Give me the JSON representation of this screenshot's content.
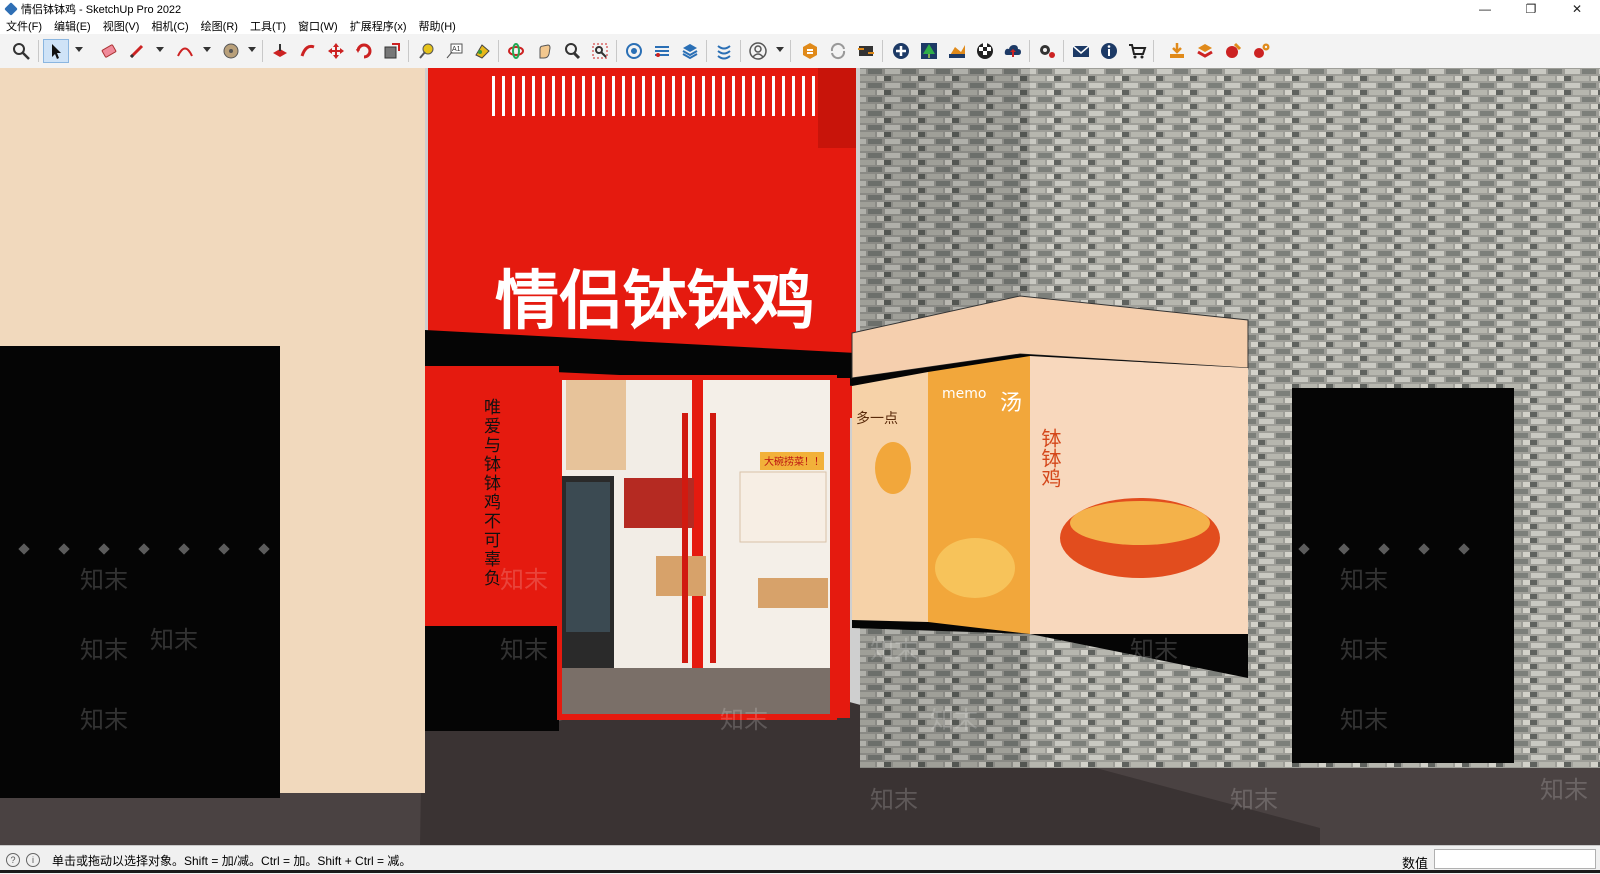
{
  "window": {
    "title": "情侣钵钵鸡 - SketchUp Pro 2022",
    "minimize": "—",
    "restore": "❐",
    "close": "✕"
  },
  "menu": [
    "文件(F)",
    "编辑(E)",
    "视图(V)",
    "相机(C)",
    "绘图(R)",
    "工具(T)",
    "窗口(W)",
    "扩展程序(x)",
    "帮助(H)"
  ],
  "toolbar": {
    "icons": [
      "zoom-extents-icon",
      "select-icon",
      "eraser-icon",
      "pencil-icon",
      "arc-icon",
      "paint-bucket-icon",
      "push-pull-icon",
      "follow-me-icon",
      "move-icon",
      "rotate-icon",
      "scale-icon",
      "tape-measure-icon",
      "text-icon",
      "paint-icon",
      "orbit-icon",
      "pan-icon",
      "zoom-icon",
      "zoom-window-icon",
      "component-icon",
      "section-icon",
      "layers-icon",
      "styles-icon",
      "account-icon",
      "warehouse-icon",
      "refresh-icon",
      "scenes-icon",
      "add-icon",
      "tree-icon",
      "sandbox-icon",
      "checker-icon",
      "upload-icon",
      "settings-icon",
      "mail-icon",
      "info-icon",
      "cart-icon",
      "import-icon",
      "export-icon",
      "render-icon",
      "render-settings-icon"
    ]
  },
  "scene": {
    "sign_text": "情侣钵钵鸡",
    "slogan": "唯爱与钵钵鸡不可辜负",
    "inner_banner": "大碗捞菜！！",
    "poster_text_1": "多一点",
    "poster_text_2": "memo",
    "poster_text_3": "汤",
    "poster_text_4": "钵钵鸡",
    "watermark": "知末",
    "colors": {
      "facade_red": "#e51a0f",
      "wall_beige": "#f1d9bd",
      "brick": "#a6a6a0",
      "poster_orange": "#f2a73b"
    }
  },
  "status": {
    "message": "单击或拖动以选择对象。Shift = 加/减。Ctrl = 加。Shift + Ctrl = 减。",
    "vcb_label": "数值",
    "vcb_value": ""
  }
}
